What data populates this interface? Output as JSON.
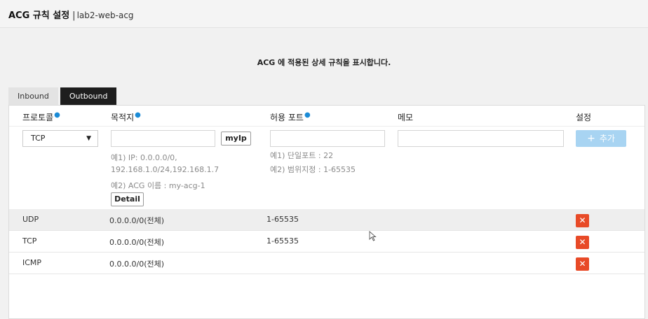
{
  "window": {
    "title": "ACG 규칙 설정",
    "separator": "|",
    "acg_name": "lab2-web-acg"
  },
  "description": "ACG 에 적용된 상세 규칙을 표시합니다.",
  "tabs": [
    {
      "label": "Inbound",
      "active": false
    },
    {
      "label": "Outbound",
      "active": true
    }
  ],
  "columns": {
    "protocol": "프로토콜",
    "destination": "목적지",
    "port": "허용 포트",
    "memo": "메모",
    "settings": "설정",
    "required_mark": "●"
  },
  "form": {
    "protocol_value": "TCP",
    "destination_value": "",
    "port_value": "",
    "memo_value": "",
    "myip_label": "myIp",
    "detail_label": "Detail",
    "add_label": "추가",
    "dest_hint_1": "예1) IP: 0.0.0.0/0,",
    "dest_hint_2": "192.168.1.0/24,192.168.1.7",
    "dest_hint_3": "예2) ACG 이름 : my-acg-1",
    "port_hint_1": "예1) 단일포트 : 22",
    "port_hint_2": "예2) 범위지정 : 1-65535"
  },
  "rules": [
    {
      "protocol": "UDP",
      "destination": "0.0.0.0/0(전체)",
      "port": "1-65535"
    },
    {
      "protocol": "TCP",
      "destination": "0.0.0.0/0(전체)",
      "port": "1-65535"
    },
    {
      "protocol": "ICMP",
      "destination": "0.0.0.0/0(전체)",
      "port": ""
    }
  ],
  "colors": {
    "required_dot": "#1b8bd6",
    "delete_button": "#e84a27",
    "add_button_disabled": "#a8d4f2",
    "active_tab": "#1e1e1e"
  },
  "icons": {
    "delete": "close-icon",
    "add": "plus-icon",
    "dropdown": "caret-down-icon"
  }
}
